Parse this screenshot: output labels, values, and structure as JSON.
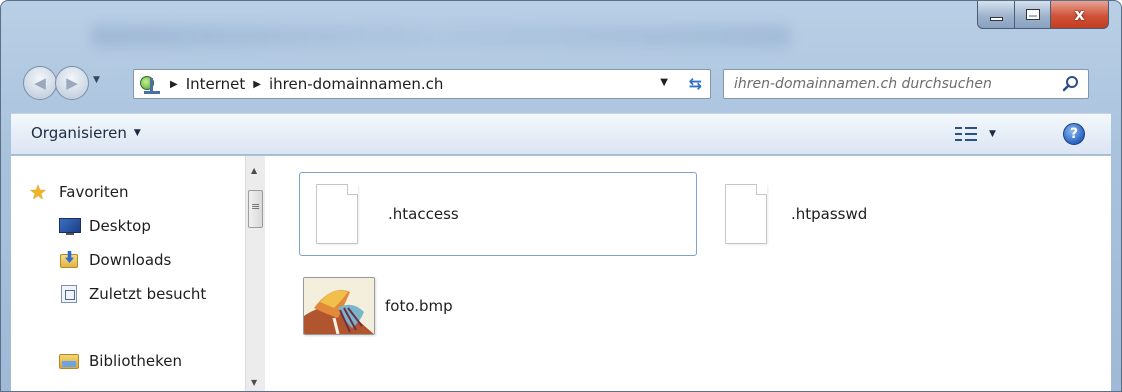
{
  "window": {
    "caption": {
      "minimize": "",
      "maximize": "",
      "close": "x"
    }
  },
  "navbar": {
    "breadcrumb": [
      "Internet",
      "ihren-domainnamen.ch"
    ],
    "search_placeholder": "ihren-domainnamen.ch durchsuchen"
  },
  "toolbar": {
    "organize_label": "Organisieren",
    "help_label": "?"
  },
  "nav_pane": {
    "items": [
      {
        "label": "Favoriten",
        "icon": "star-icon"
      },
      {
        "label": "Desktop",
        "icon": "desktop-icon"
      },
      {
        "label": "Downloads",
        "icon": "downloads-icon"
      },
      {
        "label": "Zuletzt besucht",
        "icon": "recent-places-icon"
      },
      {
        "label": "Bibliotheken",
        "icon": "libraries-icon"
      }
    ]
  },
  "files": [
    {
      "name": ".htaccess",
      "icon": "document-icon",
      "selected": true
    },
    {
      "name": ".htpasswd",
      "icon": "document-icon",
      "selected": false
    },
    {
      "name": "foto.bmp",
      "icon": "image-thumbnail",
      "selected": false
    }
  ],
  "colors": {
    "frame": "#a9c2dc",
    "toolbar": "#e6eef7",
    "selection_border": "#7da2ce",
    "close_button": "#c23c20"
  }
}
